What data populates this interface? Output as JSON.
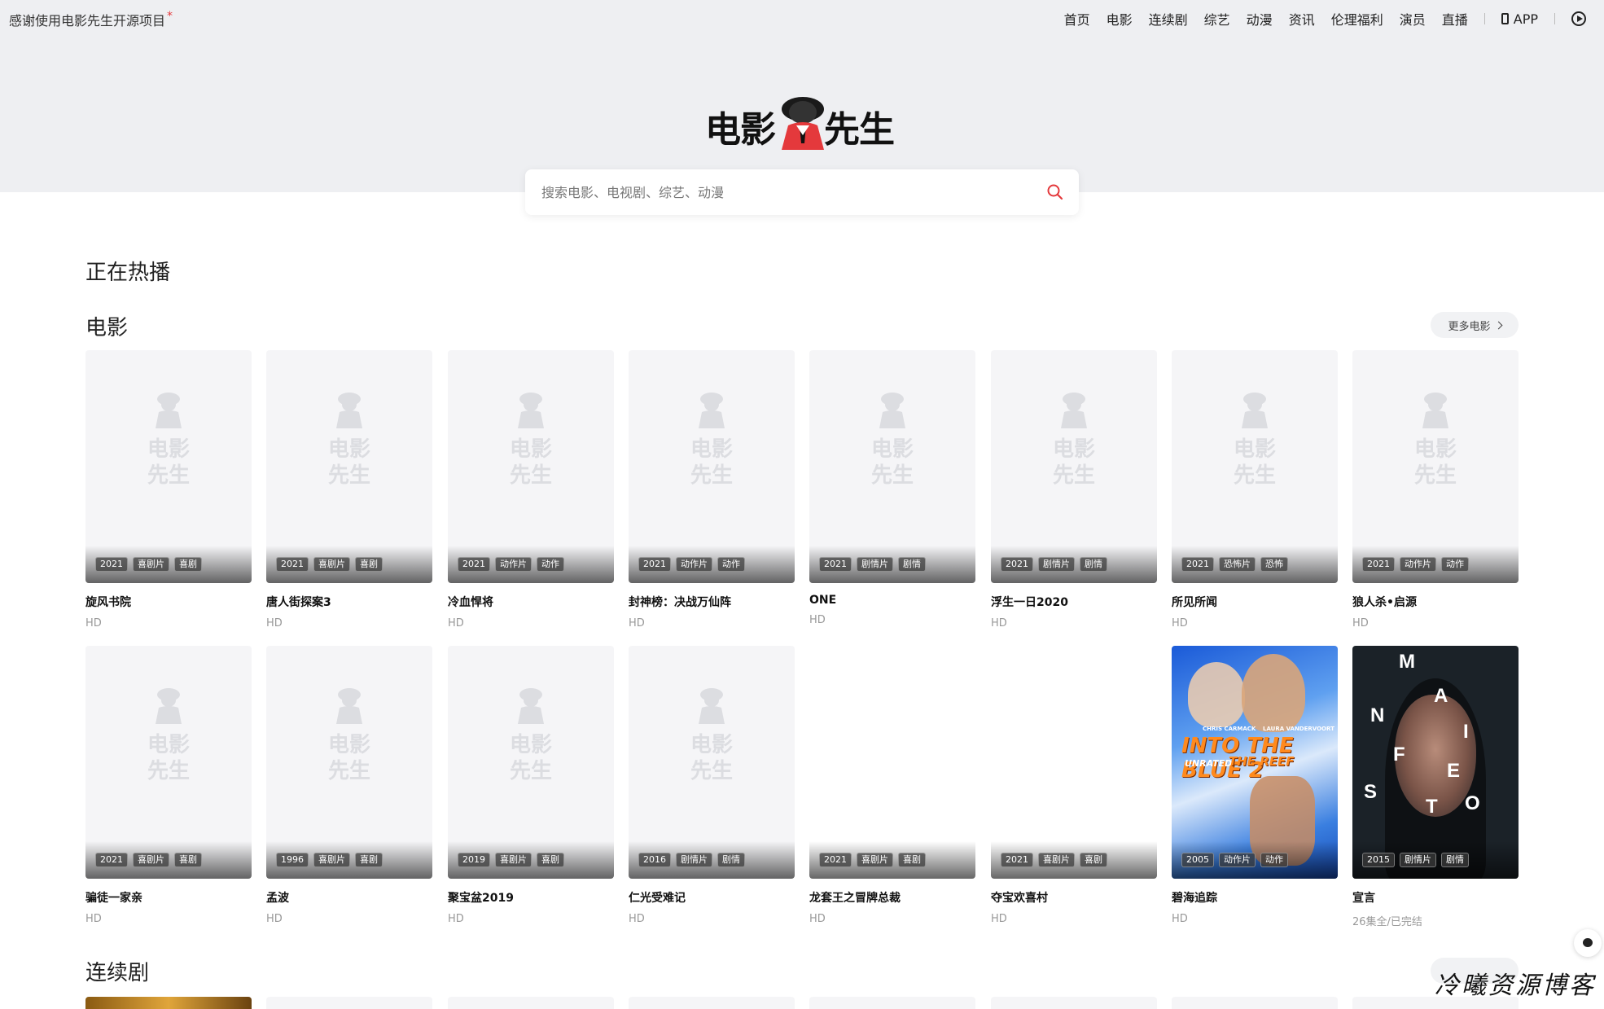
{
  "topbar": {
    "notice": "感谢使用电影先生开源项目",
    "notice_mark": "*",
    "nav": [
      "首页",
      "电影",
      "连续剧",
      "综艺",
      "动漫",
      "资讯",
      "伦理福利",
      "演员",
      "直播"
    ],
    "app_label": "APP"
  },
  "logo": {
    "left": "电影",
    "right": "先生"
  },
  "search": {
    "placeholder": "搜索电影、电视剧、综艺、动漫"
  },
  "sections": {
    "hot": "正在热播",
    "movies": "电影",
    "movies_more": "更多电影",
    "series": "连续剧"
  },
  "placeholder_text": {
    "top": "电影",
    "bottom": "先生"
  },
  "movies": [
    {
      "name": "旋风书院",
      "status": "HD",
      "year": "2021",
      "tags": [
        "喜剧片",
        "喜剧"
      ],
      "poster": "placeholder"
    },
    {
      "name": "唐人街探案3",
      "status": "HD",
      "year": "2021",
      "tags": [
        "喜剧片",
        "喜剧"
      ],
      "poster": "placeholder"
    },
    {
      "name": "冷血悍将",
      "status": "HD",
      "year": "2021",
      "tags": [
        "动作片",
        "动作"
      ],
      "poster": "placeholder"
    },
    {
      "name": "封神榜：决战万仙阵",
      "status": "HD",
      "year": "2021",
      "tags": [
        "动作片",
        "动作"
      ],
      "poster": "placeholder"
    },
    {
      "name": "ONE",
      "status": "HD",
      "year": "2021",
      "tags": [
        "剧情片",
        "剧情"
      ],
      "poster": "placeholder"
    },
    {
      "name": "浮生一日2020",
      "status": "HD",
      "year": "2021",
      "tags": [
        "剧情片",
        "剧情"
      ],
      "poster": "placeholder"
    },
    {
      "name": "所见所闻",
      "status": "HD",
      "year": "2021",
      "tags": [
        "恐怖片",
        "恐怖"
      ],
      "poster": "placeholder"
    },
    {
      "name": "狼人杀•启源",
      "status": "HD",
      "year": "2021",
      "tags": [
        "动作片",
        "动作"
      ],
      "poster": "placeholder"
    },
    {
      "name": "骗徒一家亲",
      "status": "HD",
      "year": "2021",
      "tags": [
        "喜剧片",
        "喜剧"
      ],
      "poster": "placeholder"
    },
    {
      "name": "孟波",
      "status": "HD",
      "year": "1996",
      "tags": [
        "喜剧片",
        "喜剧"
      ],
      "poster": "placeholder"
    },
    {
      "name": "聚宝盆2019",
      "status": "HD",
      "year": "2019",
      "tags": [
        "喜剧片",
        "喜剧"
      ],
      "poster": "placeholder"
    },
    {
      "name": "仁光受难记",
      "status": "HD",
      "year": "2016",
      "tags": [
        "剧情片",
        "剧情"
      ],
      "poster": "placeholder"
    },
    {
      "name": "龙套王之冒牌总裁",
      "status": "HD",
      "year": "2021",
      "tags": [
        "喜剧片",
        "喜剧"
      ],
      "poster": "blank"
    },
    {
      "name": "夺宝欢喜村",
      "status": "HD",
      "year": "2021",
      "tags": [
        "喜剧片",
        "喜剧"
      ],
      "poster": "blank"
    },
    {
      "name": "碧海追踪",
      "status": "HD",
      "year": "2005",
      "tags": [
        "动作片",
        "动作"
      ],
      "poster": "blue"
    },
    {
      "name": "宣言",
      "status": "26集全/已完结",
      "year": "2015",
      "tags": [
        "剧情片",
        "剧情"
      ],
      "poster": "dark"
    }
  ],
  "posters": {
    "into_the_blue": {
      "title_main": "INTO THE BLUE 2",
      "title_sub": "THE REEF",
      "badge": "UNRATED",
      "credit_1": "CHRIS CARMACK",
      "credit_2": "LAURA VANDERVOORT"
    },
    "manifesto_letters": [
      "M",
      "A",
      "N",
      "I",
      "F",
      "E",
      "S",
      "T",
      "O"
    ]
  },
  "watermark": "冷曦资源博客",
  "colors": {
    "accent": "#e4393c",
    "hero_bg": "#eeeff2"
  }
}
